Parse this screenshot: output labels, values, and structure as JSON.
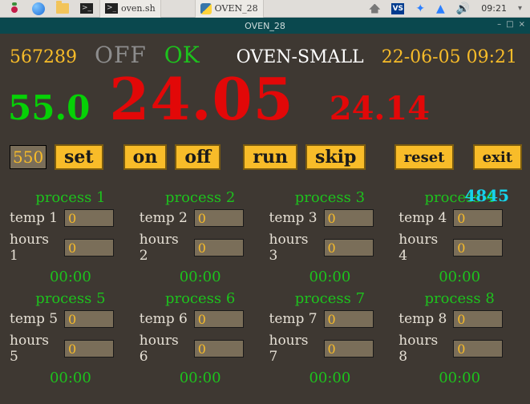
{
  "taskbar": {
    "app1": "oven.sh",
    "app2": "OVEN_28",
    "vs": "VS",
    "clock": "09:21"
  },
  "titlebar": {
    "title": "OVEN_28"
  },
  "status": {
    "id": "567289",
    "mode": "OFF",
    "ok": "OK",
    "name": "OVEN-SMALL",
    "datetime": "22-06-05 09:21"
  },
  "readings": {
    "setpoint": "55.0",
    "process_value": "24.05",
    "secondary": "24.14"
  },
  "controls": {
    "sp_input": "550",
    "set": "set",
    "on": "on",
    "off": "off",
    "run": "run",
    "skip": "skip",
    "reset": "reset",
    "exit": "exit"
  },
  "counter": "4845",
  "processes": [
    {
      "title": "process 1",
      "temp_label": "temp 1",
      "temp": "0",
      "hours_label": "hours 1",
      "hours": "0",
      "timer": "00:00"
    },
    {
      "title": "process 2",
      "temp_label": "temp 2",
      "temp": "0",
      "hours_label": "hours 2",
      "hours": "0",
      "timer": "00:00"
    },
    {
      "title": "process 3",
      "temp_label": "temp 3",
      "temp": "0",
      "hours_label": "hours 3",
      "hours": "0",
      "timer": "00:00"
    },
    {
      "title": "process 4",
      "temp_label": "temp 4",
      "temp": "0",
      "hours_label": "hours 4",
      "hours": "0",
      "timer": "00:00"
    },
    {
      "title": "process 5",
      "temp_label": "temp 5",
      "temp": "0",
      "hours_label": "hours 5",
      "hours": "0",
      "timer": "00:00"
    },
    {
      "title": "process 6",
      "temp_label": "temp 6",
      "temp": "0",
      "hours_label": "hours 6",
      "hours": "0",
      "timer": "00:00"
    },
    {
      "title": "process 7",
      "temp_label": "temp 7",
      "temp": "0",
      "hours_label": "hours 7",
      "hours": "0",
      "timer": "00:00"
    },
    {
      "title": "process 8",
      "temp_label": "temp 8",
      "temp": "0",
      "hours_label": "hours 8",
      "hours": "0",
      "timer": "00:00"
    }
  ]
}
